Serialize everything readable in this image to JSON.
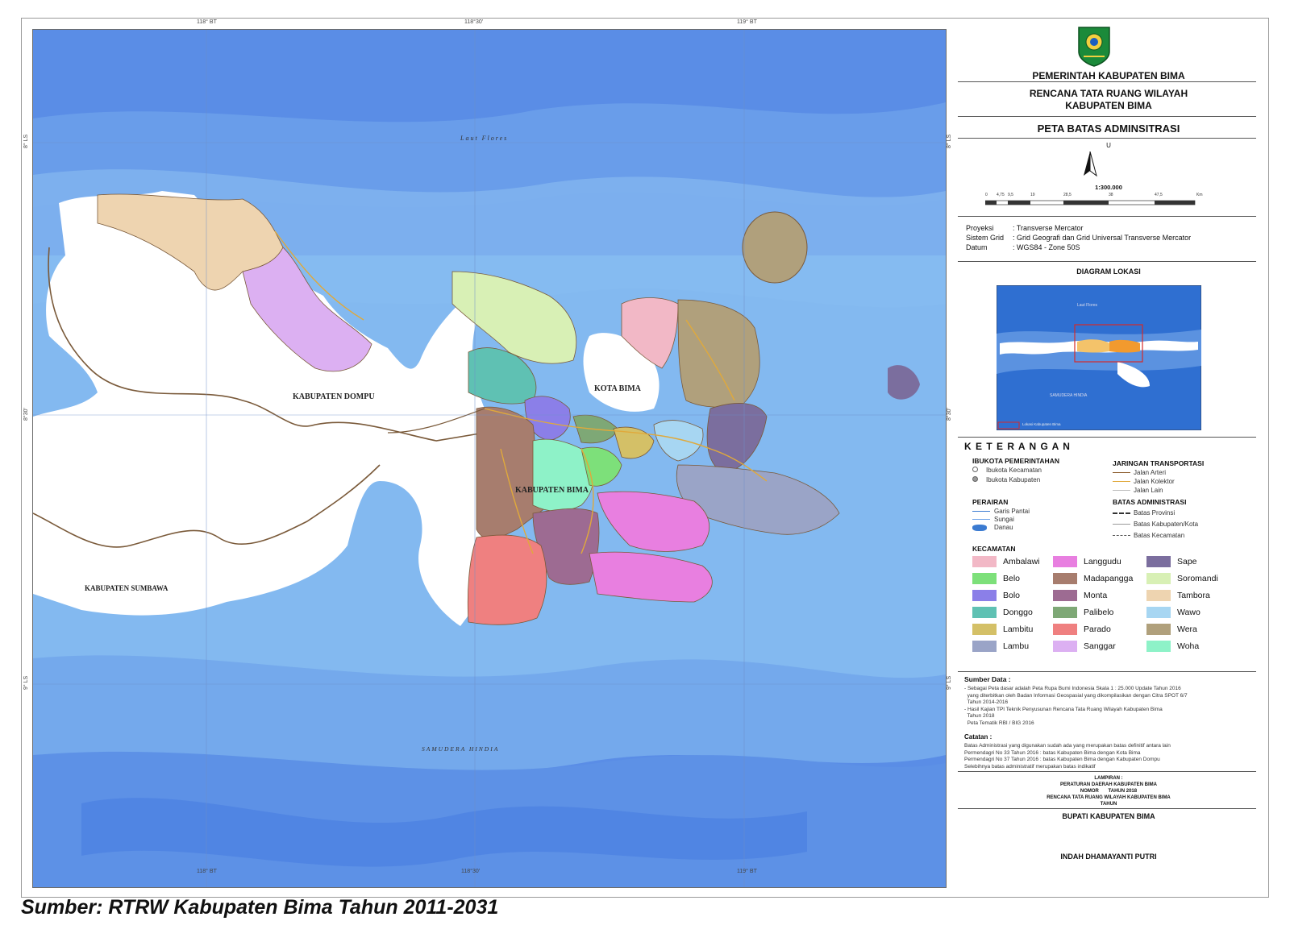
{
  "map": {
    "place_labels": {
      "laut_flores": "Laut Flores",
      "samudera_hindia": "SAMUDERA HINDIA",
      "kab_dompu": "KABUPATEN DOMPU",
      "kab_sumbawa": "KABUPATEN SUMBAWA",
      "kab_bima": "KABUPATEN BIMA",
      "kota_bima": "KOTA BIMA"
    },
    "grid_labels": {
      "lon_1": "118° BT",
      "lon_2": "118°30'",
      "lon_3": "119° BT",
      "lat_1": "8° LS",
      "lat_2": "8°30'",
      "lat_3": "9° LS"
    },
    "colors": {
      "sea_deep": "#4f86e4",
      "sea_mid": "#6ea0ea",
      "sea_shallow": "#8ec3ef",
      "land_outside": "#ffffff",
      "boundary": "#7a5a3a",
      "road_collector": "#e0a93b"
    }
  },
  "panel": {
    "government": "PEMERINTAH KABUPATEN BIMA",
    "plan_line1": "RENCANA TATA RUANG WILAYAH",
    "plan_line2": "KABUPATEN BIMA",
    "map_title": "PETA BATAS ADMINSITRASI",
    "north_label": "U",
    "scale": "1:300.000",
    "scale_ticks": [
      "0",
      "4,75",
      "9,5",
      "19",
      "28,5",
      "38",
      "47,5",
      "Km"
    ],
    "projection": [
      {
        "key": "Proyeksi",
        "value": ": Transverse Mercator"
      },
      {
        "key": "Sistem Grid",
        "value": ": Grid Geografi dan Grid Universal Transverse Mercator"
      },
      {
        "key": "Datum",
        "value": ": WGS84 - Zone 50S"
      }
    ],
    "location_diagram_title": "DIAGRAM LOKASI",
    "inset_labels": {
      "sea_north": "Laut Flores",
      "sea_south": "SAMUDERA HINDIA",
      "key": "Lokasi Kabupaten Bima"
    },
    "legend_title": "K E T E R A N G A N",
    "ibukota": {
      "title": "IBUKOTA PEMERINTAHAN",
      "items": [
        "Ibukota Kecamatan",
        "Ibukota Kabupaten"
      ]
    },
    "jaringan": {
      "title": "JARINGAN TRANSPORTASI",
      "items": [
        "Jalan Arteri",
        "Jalan Kolektor",
        "Jalan Lain"
      ]
    },
    "perairan": {
      "title": "PERAIRAN",
      "items": [
        "Garis Pantai",
        "Sungai",
        "Danau"
      ]
    },
    "batas": {
      "title": "BATAS ADMINISTRASI",
      "items": [
        "Batas Provinsi",
        "Batas Kabupaten/Kota",
        "Batas Kecamatan"
      ]
    },
    "kecamatan_title": "KECAMATAN",
    "kecamatan": [
      {
        "name": "Ambalawi",
        "color": "#f2b8c6"
      },
      {
        "name": "Belo",
        "color": "#7de07a"
      },
      {
        "name": "Bolo",
        "color": "#8b7fe8"
      },
      {
        "name": "Donggo",
        "color": "#5fc1b3"
      },
      {
        "name": "Lambitu",
        "color": "#d4c067"
      },
      {
        "name": "Lambu",
        "color": "#9aa4c7"
      },
      {
        "name": "Langgudu",
        "color": "#e87fe0"
      },
      {
        "name": "Madapangga",
        "color": "#a77d6e"
      },
      {
        "name": "Monta",
        "color": "#9d6b92"
      },
      {
        "name": "Palibelo",
        "color": "#7ea876"
      },
      {
        "name": "Parado",
        "color": "#ef8080"
      },
      {
        "name": "Sanggar",
        "color": "#dcb0f2"
      },
      {
        "name": "Sape",
        "color": "#7b6e9e"
      },
      {
        "name": "Soromandi",
        "color": "#d8f0b5"
      },
      {
        "name": "Tambora",
        "color": "#eed4b0"
      },
      {
        "name": "Wawo",
        "color": "#a7d6f2"
      },
      {
        "name": "Wera",
        "color": "#b0a07c"
      },
      {
        "name": "Woha",
        "color": "#8ef2c8"
      }
    ],
    "sumber_title": "Sumber Data :",
    "sumber_lines": [
      "- Sebagai Peta dasar adalah Peta Rupa Bumi Indonesia Skala 1 : 25.000 Update Tahun 2016",
      "  yang diterbitkan oleh Badan Informasi Geospasial yang dikompilasikan dengan Citra SPOT 6/7",
      "  Tahun 2014-2016",
      "- Hasil Kajian TPI Teknik Penyusunan Rencana Tata Ruang Wilayah Kabupaten Bima",
      "  Tahun 2018",
      "  Peta Tematik RBI / BIG 2016"
    ],
    "catatan_title": "Catatan :",
    "catatan_lines": [
      "Batas Administrasi yang digunakan sudah ada yang merupakan batas definitif antara lain",
      "Permendagri No 33 Tahun 2016 : batas Kabupaten Bima dengan Kota Bima",
      "Permendagri No 37 Tahun 2016 : batas Kabupaten Bima dengan Kabupaten Dompu",
      "Selebihnya batas administratif merupakan batas indikatif"
    ],
    "lampiran": [
      "LAMPIRAN :",
      "PERATURAN DAERAH KABUPATEN BIMA",
      "NOMOR       TAHUN 2018",
      "RENCANA TATA RUANG WILAYAH KABUPATEN BIMA",
      "TAHUN"
    ],
    "bupati_title": "BUPATI KABUPATEN BIMA",
    "bupati_name": "INDAH DHAMAYANTI PUTRI"
  },
  "caption": "Sumber: RTRW Kabupaten Bima Tahun 2011-2031"
}
